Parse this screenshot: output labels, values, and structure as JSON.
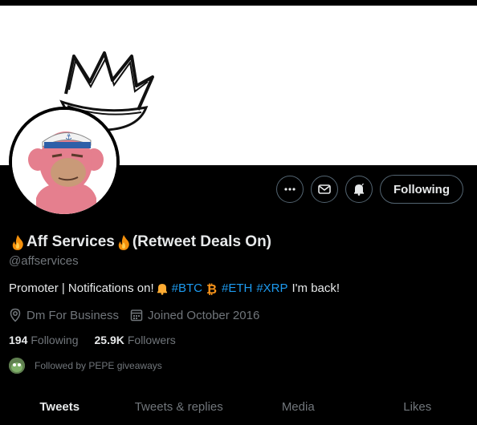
{
  "profile": {
    "display_name_prefix_icon": "fire-icon",
    "display_name": "Aff Services",
    "display_name_suffix_icon": "fire-icon",
    "display_name_suffix": "(Retweet Deals On)",
    "handle": "@affservices"
  },
  "actions": {
    "more_icon": "more-icon",
    "message_icon": "mail-icon",
    "notify_icon": "bell-icon",
    "follow_label": "Following"
  },
  "bio": {
    "part1": "Promoter | Notifications on!",
    "bell_icon": "bell-emoji-icon",
    "tag_btc": "#BTC",
    "btc_icon": "bitcoin-icon",
    "tag_eth": "#ETH",
    "tag_xrp": "#XRP",
    "part2": "I'm back!"
  },
  "meta": {
    "location": "Dm For Business",
    "joined": "Joined October 2016"
  },
  "counts": {
    "following_value": "194",
    "following_label": "Following",
    "followers_value": "25.9K",
    "followers_label": "Followers"
  },
  "followed_by": "Followed by PEPE giveaways",
  "tabs": [
    {
      "label": "Tweets"
    },
    {
      "label": "Tweets & replies"
    },
    {
      "label": "Media"
    },
    {
      "label": "Likes"
    }
  ],
  "colors": {
    "accent": "#1d9bf0",
    "background": "#000000",
    "muted": "#71767b",
    "btc": "#f7931a"
  }
}
